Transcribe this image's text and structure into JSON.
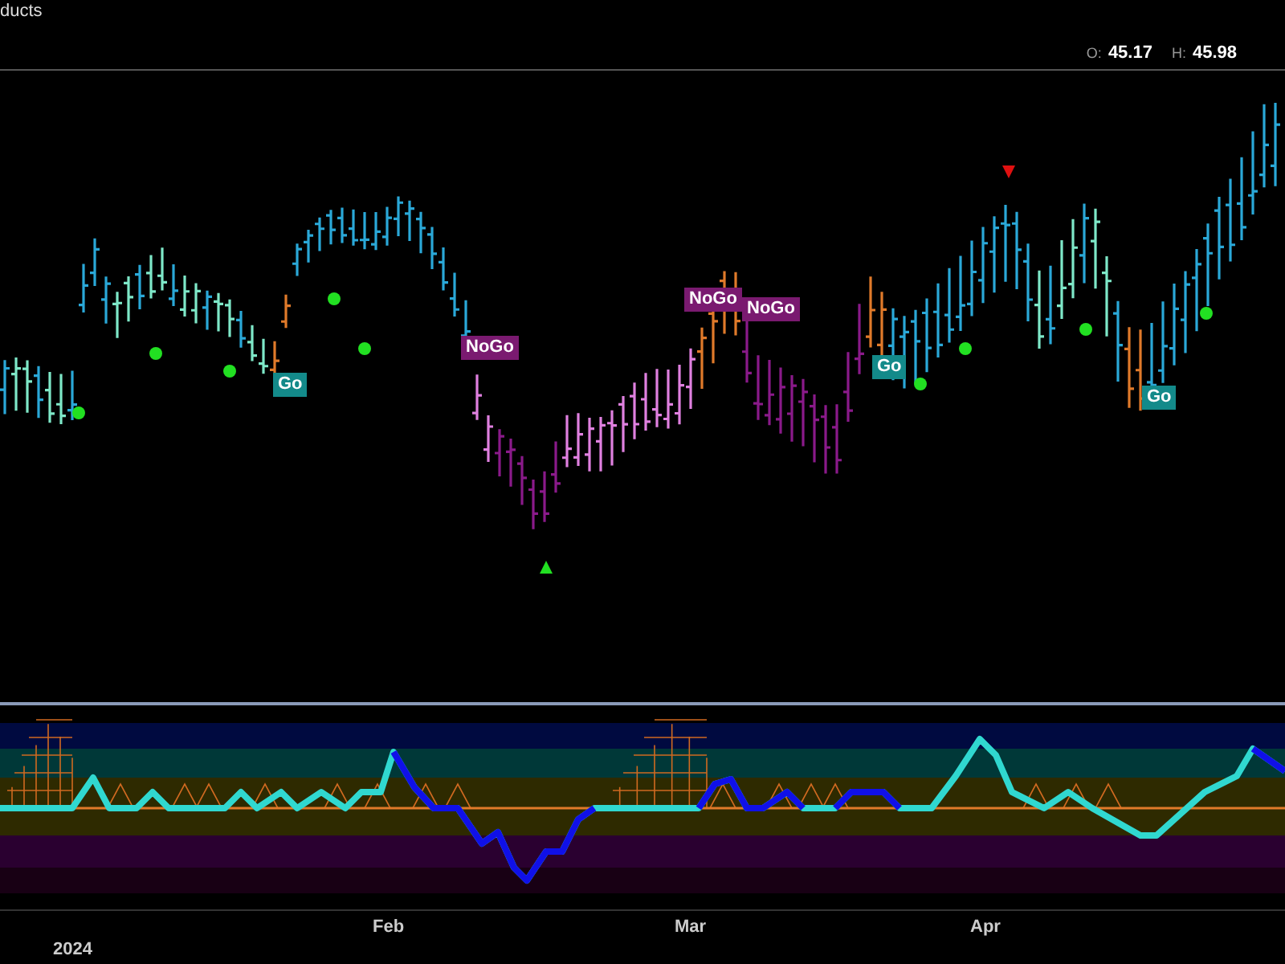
{
  "header": {
    "title": "ducts",
    "quote": [
      {
        "label": "O:",
        "value": "45.17"
      },
      {
        "label": "H:",
        "value": "45.98"
      }
    ]
  },
  "signals": [
    {
      "text": "Go",
      "kind": "go"
    },
    {
      "text": "NoGo",
      "kind": "nogo"
    },
    {
      "text": "NoGo",
      "kind": "nogo"
    },
    {
      "text": "NoGo",
      "kind": "nogo"
    },
    {
      "text": "Go",
      "kind": "go"
    },
    {
      "text": "Go",
      "kind": "go"
    }
  ],
  "x_axis": {
    "labels": [
      "2024",
      "Feb",
      "Mar",
      "Apr"
    ]
  }
}
